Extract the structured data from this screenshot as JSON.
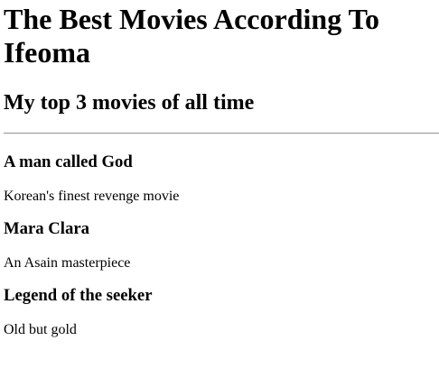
{
  "page": {
    "title": "The Best Movies According To Ifeoma",
    "subtitle": "My top 3 movies of all time"
  },
  "movies": [
    {
      "title": "A man called God",
      "description": "Korean's finest revenge movie"
    },
    {
      "title": "Mara Clara",
      "description": "An Asain masterpiece"
    },
    {
      "title": "Legend of the seeker",
      "description": "Old but gold"
    }
  ]
}
